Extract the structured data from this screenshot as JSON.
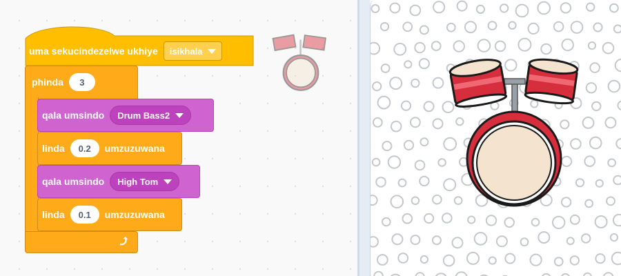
{
  "script": {
    "hat": {
      "label": "uma sekucindezelwe ukhiye",
      "key_value": "isikhala"
    },
    "repeat": {
      "label": "phinda",
      "count": "3"
    },
    "steps": [
      {
        "kind": "play",
        "label": "qala umsindo",
        "sound": "Drum Bass2"
      },
      {
        "kind": "wait",
        "label": "linda",
        "value": "0.2",
        "unit": "umzuzuwana"
      },
      {
        "kind": "play",
        "label": "qala umsindo",
        "sound": "High Tom"
      },
      {
        "kind": "wait",
        "label": "linda",
        "value": "0.1",
        "unit": "umzuzuwana"
      }
    ]
  },
  "icons": {
    "dropdown": "caret-down-icon",
    "loop": "loop-arrow-icon",
    "sprite": "drum-kit-sprite"
  },
  "colors": {
    "events": "#ffbf00",
    "control": "#ffab19",
    "sound": "#cf63cf",
    "drum_red": "#d62e3c",
    "drum_skin": "#f3e3cf"
  }
}
